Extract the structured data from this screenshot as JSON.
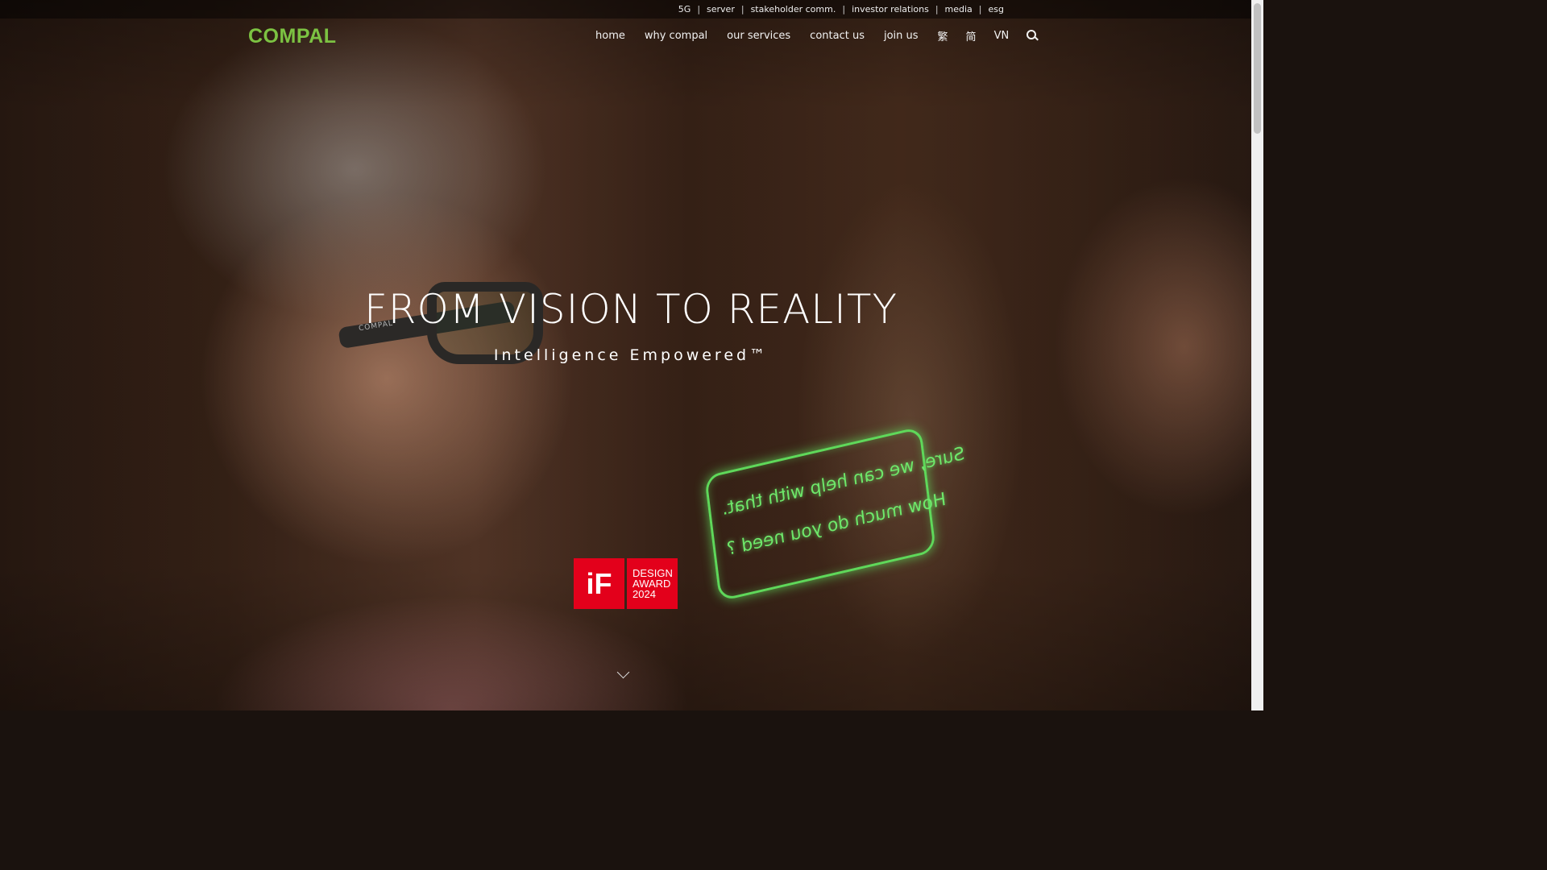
{
  "utility_nav": {
    "items": [
      "5G",
      "server",
      "stakeholder comm.",
      "investor relations",
      "media",
      "esg"
    ],
    "separator": "|"
  },
  "logo": {
    "text": "COMPAL"
  },
  "main_nav": {
    "items": [
      "home",
      "why compal",
      "our services",
      "contact us",
      "join us"
    ],
    "languages": [
      "繁",
      "简",
      "VN"
    ]
  },
  "hero": {
    "headline": "FROM VISION TO REALITY",
    "subheadline": "Intelligence Empowered™",
    "glasses_brand": "COMPAL",
    "hologram": {
      "line1": "Sure, we can help with that.",
      "line2": "How much do you need ?"
    },
    "accent_color": "#7cc242",
    "hologram_color": "#5fd85a"
  },
  "award": {
    "logo": "iF",
    "lines": [
      "DESIGN",
      "AWARD",
      "2024"
    ],
    "color": "#e3001b"
  },
  "icons": {
    "search": "search-icon",
    "scroll": "chevron-down-icon"
  }
}
